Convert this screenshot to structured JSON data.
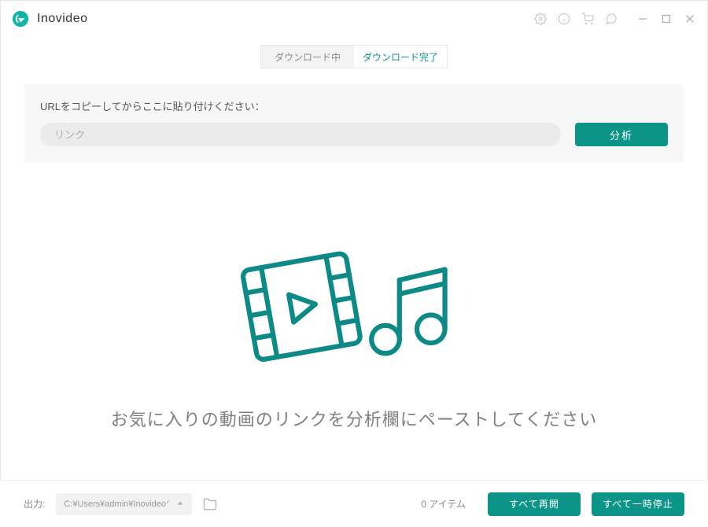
{
  "app": {
    "title": "Inovideo"
  },
  "tabs": {
    "downloading": "ダウンロード中",
    "completed": "ダウンロード完了"
  },
  "url_section": {
    "label": "URLをコピーしてからここに貼り付けください：",
    "placeholder": "リンク",
    "analyze": "分析"
  },
  "empty_state": {
    "text": "お気に入りの動画のリンクを分析欄にペーストしてください"
  },
  "footer": {
    "output_label": "出力:",
    "path": "C:¥Users¥admin¥Inovideoᐟ",
    "item_count": "0 アイテム",
    "resume_all": "すべて再開",
    "pause_all": "すべて一時停止"
  }
}
